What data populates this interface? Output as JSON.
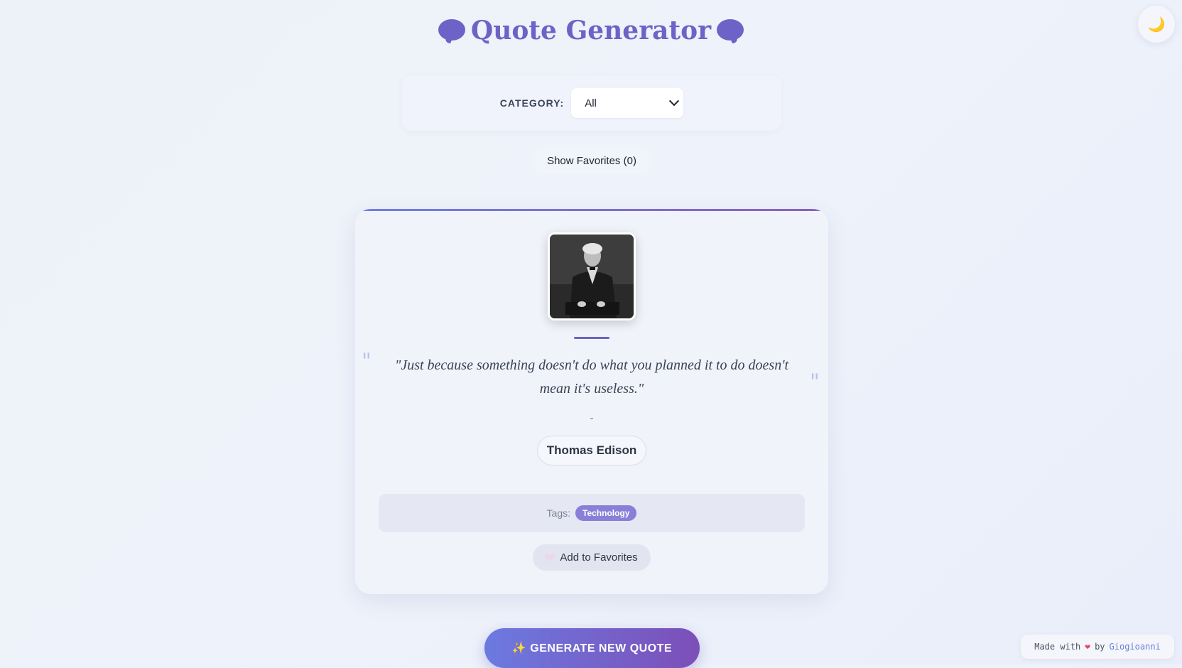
{
  "header": {
    "title": "Quote Generator",
    "icon_left": "speech-bubble-icon",
    "icon_right": "speech-bubble-icon",
    "theme_toggle_icon": "🌙"
  },
  "filter": {
    "label": "CATEGORY:",
    "selected": "All"
  },
  "favorites_button": "Show Favorites (0)",
  "quote_card": {
    "quote": "\"Just because something doesn't do what you planned it to do doesn't mean it's useless.\"",
    "quote_open_mark": "\"",
    "quote_close_mark": "\"",
    "dash": "-",
    "author": "Thomas Edison",
    "tags_label": "Tags:",
    "tags": [
      "Technology"
    ],
    "add_favorite_label": "Add to Favorites"
  },
  "generate_button": "✨ GENERATE NEW QUOTE",
  "footer": {
    "made_with": "Made with",
    "heart": "❤",
    "by": "by",
    "author_link": "Giogioanni"
  },
  "colors": {
    "accent": "#6c63c7",
    "tag": "#8a7fd8",
    "generate_start": "#6c7ae0",
    "generate_end": "#7c4fb8"
  }
}
